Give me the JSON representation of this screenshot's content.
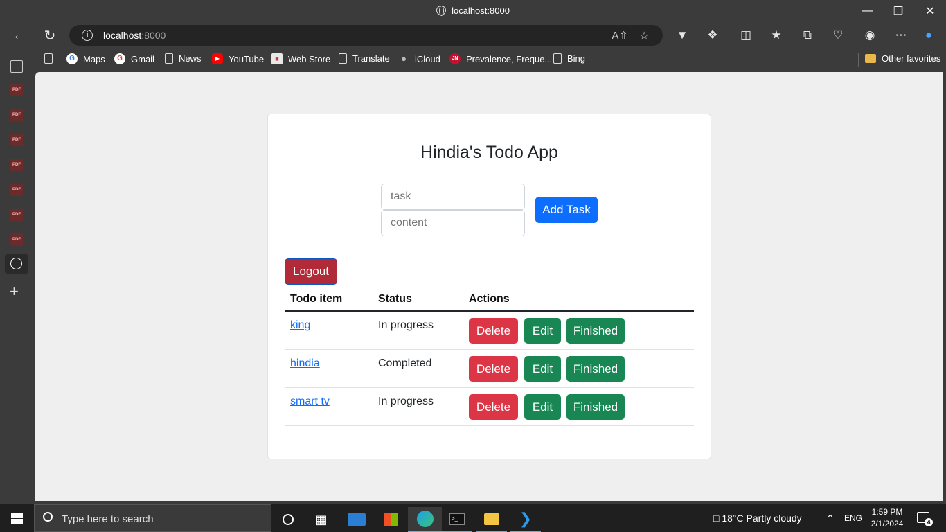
{
  "browser": {
    "title": "localhost:8000",
    "url_host": "localhost",
    "url_port": ":8000"
  },
  "bookmarks": [
    {
      "label": "Maps",
      "icon": "google-icon"
    },
    {
      "label": "Gmail",
      "icon": "google-icon"
    },
    {
      "label": "News",
      "icon": "document-icon"
    },
    {
      "label": "YouTube",
      "icon": "youtube-icon"
    },
    {
      "label": "Web Store",
      "icon": "webstore-icon"
    },
    {
      "label": "Translate",
      "icon": "document-icon"
    },
    {
      "label": "iCloud",
      "icon": "apple-icon"
    },
    {
      "label": "Prevalence, Freque...",
      "icon": "jn-icon"
    },
    {
      "label": "Bing",
      "icon": "document-icon"
    }
  ],
  "other_favorites": "Other favorites",
  "app": {
    "title": "Hindia's Todo App",
    "task_placeholder": "task",
    "content_placeholder": "content",
    "add_label": "Add Task",
    "logout_label": "Logout",
    "table": {
      "headers": [
        "Todo item",
        "Status",
        "Actions"
      ],
      "rows": [
        {
          "item": "king",
          "status": "In progress"
        },
        {
          "item": "hindia",
          "status": "Completed"
        },
        {
          "item": "smart tv",
          "status": "In progress"
        }
      ],
      "delete_label": "Delete",
      "edit_label": "Edit",
      "finished_label": "Finished"
    }
  },
  "taskbar": {
    "search_placeholder": "Type here to search",
    "weather": "18°C  Partly cloudy",
    "lang": "ENG",
    "time": "1:59 PM",
    "date": "2/1/2024",
    "notifications": "4"
  },
  "colors": {
    "primary": "#0d6efd",
    "danger": "#dc3545",
    "success": "#198754"
  }
}
